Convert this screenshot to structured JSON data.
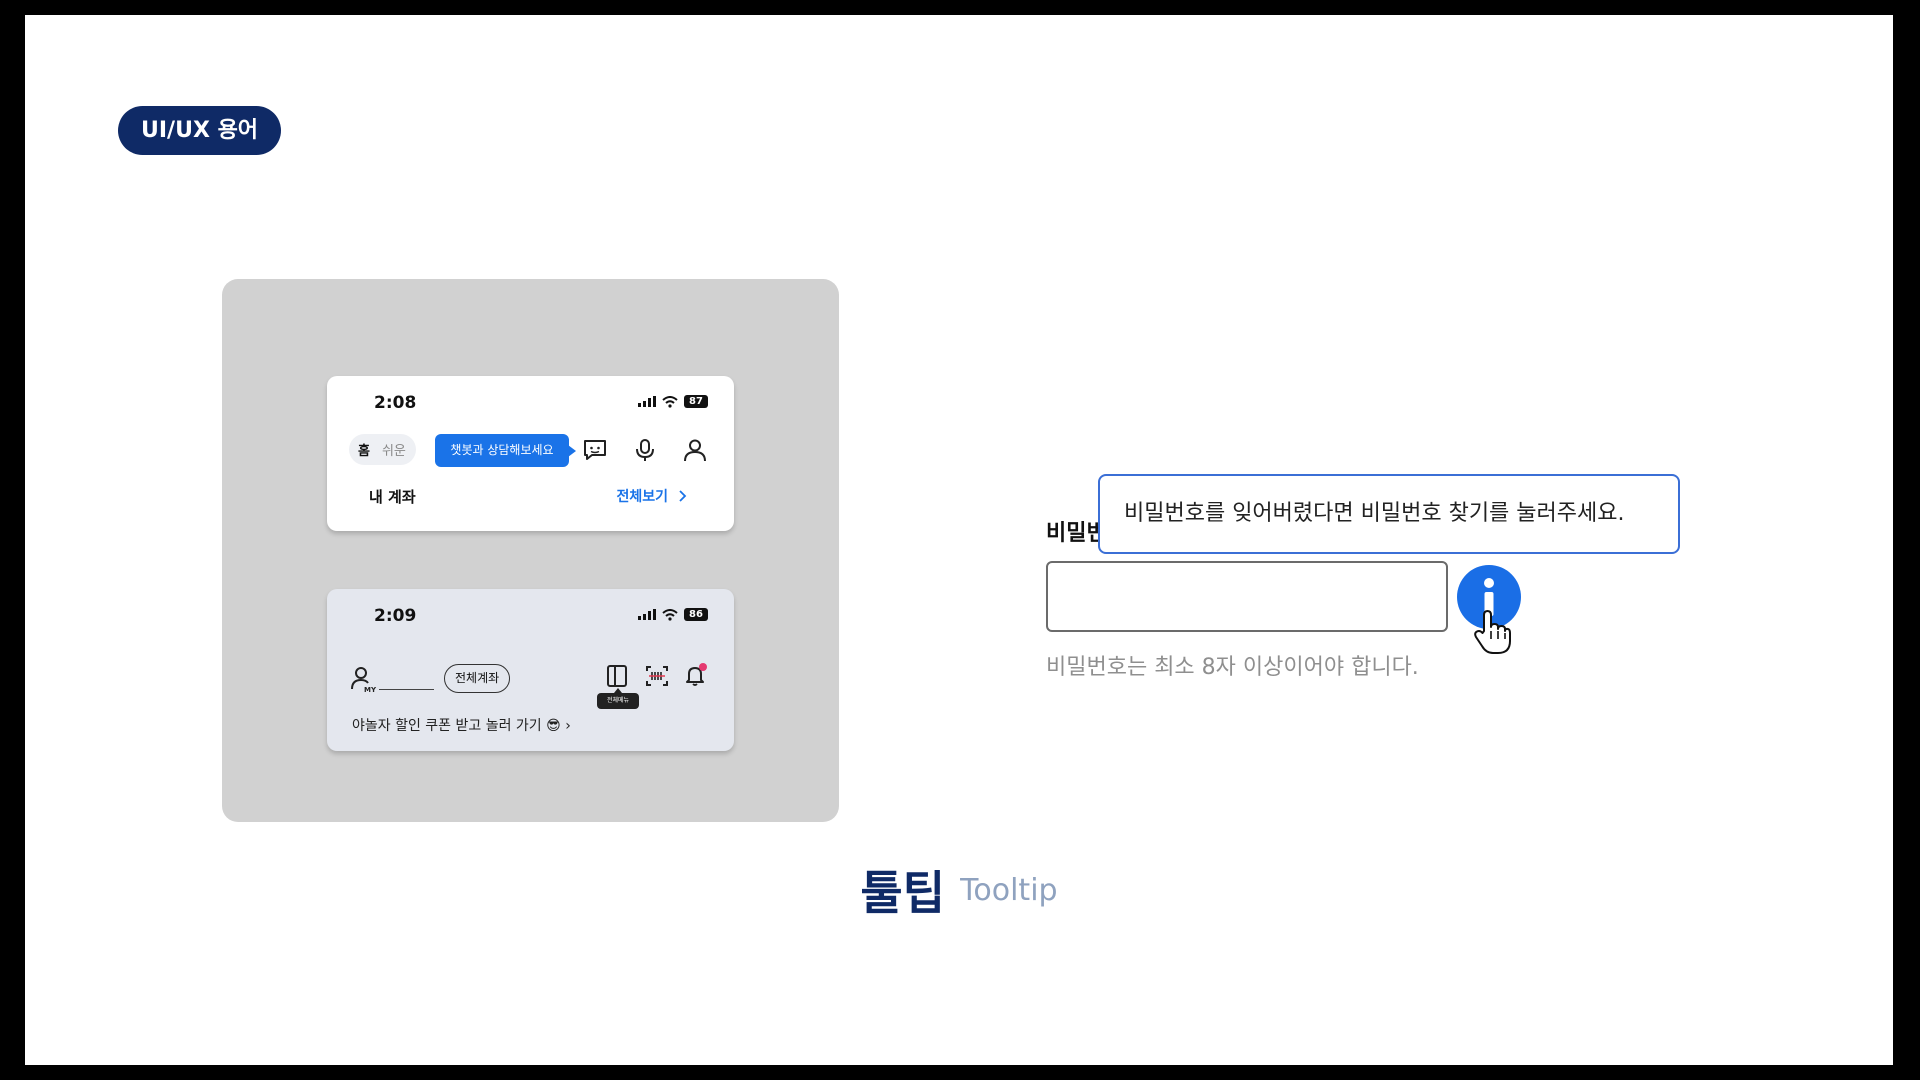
{
  "tag": {
    "label": "UI/UX 용어"
  },
  "phone_one": {
    "time": "2:08",
    "battery": "87",
    "segment": {
      "active": "홈",
      "inactive": "쉬운"
    },
    "chat_tooltip": "챗봇과 상담해보세요",
    "section_title": "내 계좌",
    "view_all": "전체보기"
  },
  "phone_two": {
    "time": "2:09",
    "battery": "86",
    "avatar_label": "MY",
    "all_accounts": "전체계좌",
    "mini_tooltip": "전체메뉴",
    "promo": "야놀자 할인 쿠폰 받고 놀러 가기",
    "promo_emoji": "😎"
  },
  "form": {
    "label": "비밀번",
    "input_value": "",
    "helper": "비밀번호는 최소 8자 이상이어야 합니다.",
    "tooltip": "비밀번호를 잊어버렸다면 비밀번호 찾기를 눌러주세요."
  },
  "caption": {
    "korean": "툴팁",
    "english": "Tooltip"
  },
  "colors": {
    "navy": "#0f2a66",
    "accent_blue": "#1a6ee6",
    "caption_grey": "#8fa2bf"
  }
}
